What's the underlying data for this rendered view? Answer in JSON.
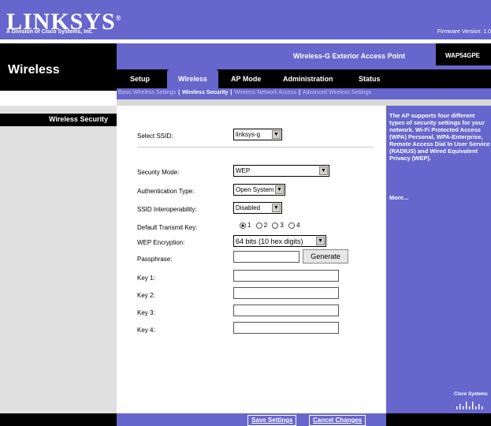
{
  "brand": {
    "logo": "LINKSYS",
    "registered": "®",
    "sub": "A Division of Cisco Systems, Inc.",
    "firmware": "Firmware Version: 1.0"
  },
  "header": {
    "page_title": "Wireless",
    "product_name": "Wireless-G Exterior Access Point",
    "model": "WAP54GPE"
  },
  "tabs": [
    {
      "label": "Setup"
    },
    {
      "label": "Wireless"
    },
    {
      "label": "AP Mode"
    },
    {
      "label": "Administration"
    },
    {
      "label": "Status"
    }
  ],
  "subtabs": [
    {
      "label": "Basic Wireless Settings"
    },
    {
      "label": "Wireless Security"
    },
    {
      "label": "Wireless Network Access"
    },
    {
      "label": "Advanced Wireless Settings"
    }
  ],
  "section": {
    "label": "Wireless Security"
  },
  "form": {
    "ssid": {
      "label": "Select SSID:",
      "value": "linksys-g"
    },
    "security_mode": {
      "label": "Security Mode:",
      "value": "WEP"
    },
    "auth_type": {
      "label": "Authentication Type:",
      "value": "Open System"
    },
    "ssid_interop": {
      "label": "SSID Interoperability:",
      "value": "Disabled"
    },
    "tx_key": {
      "label": "Default Transmit Key:",
      "options": [
        "1",
        "2",
        "3",
        "4"
      ],
      "selected": "1"
    },
    "wep_enc": {
      "label": "WEP Encryption:",
      "value": "64 bits (10 hex digits)"
    },
    "passphrase": {
      "label": "Passphrase:",
      "value": ""
    },
    "generate_label": "Generate",
    "key1": {
      "label": "Key 1:",
      "value": ""
    },
    "key2": {
      "label": "Key 2:",
      "value": ""
    },
    "key3": {
      "label": "Key 3:",
      "value": ""
    },
    "key4": {
      "label": "Key 4:",
      "value": ""
    }
  },
  "help": {
    "text": "The AP supports four different types of security settings for your network. Wi-Fi Protected Access (WPA) Personal, WPA-Enterprise, Remote Access Dial In User Service (RADIUS) and Wired Equivalent Privacy (WEP).",
    "more": "More..."
  },
  "footer": {
    "save_label": "Save Settings",
    "cancel_label": "Cancel Changes"
  },
  "cisco": {
    "label": "Cisco Systems"
  },
  "colors": {
    "brand_purple": "#6666cc",
    "black": "#000000"
  }
}
